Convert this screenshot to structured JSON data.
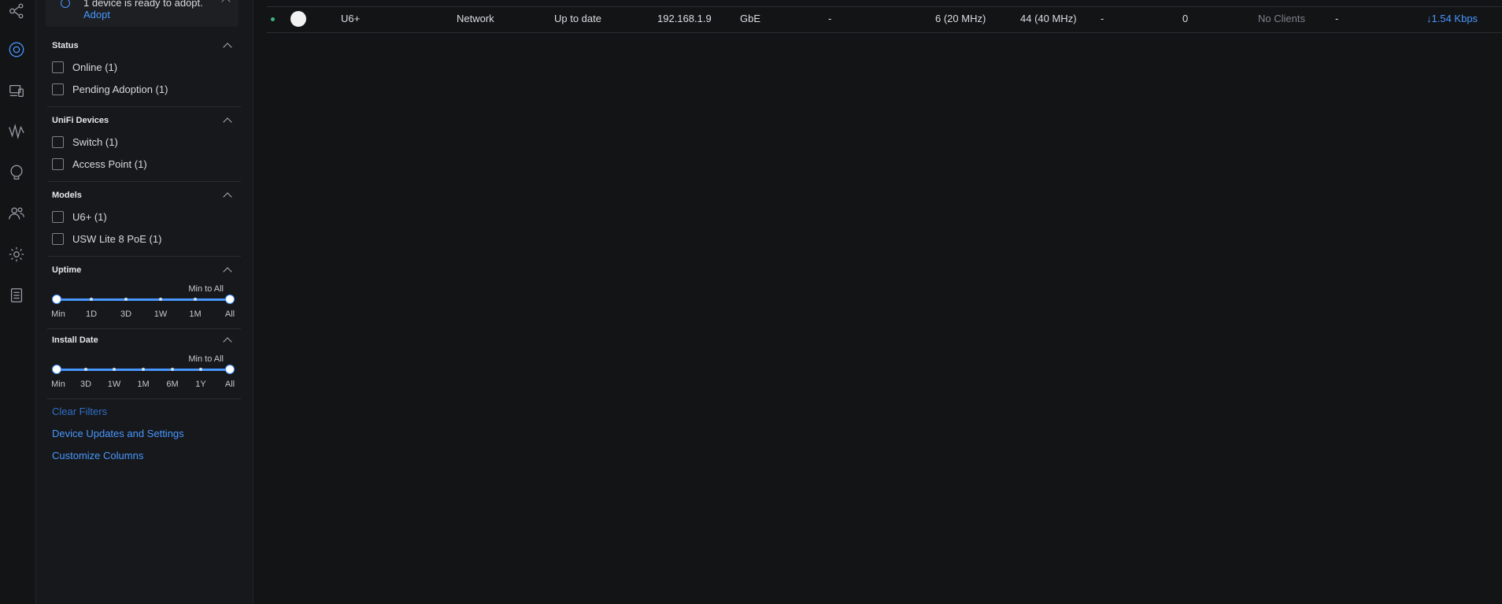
{
  "notice": {
    "text": "1 device is ready to adopt.",
    "link": "Adopt"
  },
  "nav_icons": [
    "topology-icon",
    "devices-icon",
    "client-devices-icon",
    "statistics-icon",
    "insights-icon",
    "clients-icon",
    "settings-icon",
    "logs-icon"
  ],
  "filters": {
    "status": {
      "title": "Status",
      "options": [
        "Online (1)",
        "Pending Adoption (1)"
      ]
    },
    "unifi_devices": {
      "title": "UniFi Devices",
      "options": [
        "Switch (1)",
        "Access Point (1)"
      ]
    },
    "models": {
      "title": "Models",
      "options": [
        "U6+ (1)",
        "USW Lite 8 PoE (1)"
      ]
    },
    "uptime": {
      "title": "Uptime",
      "range": "Min to All",
      "ticks": [
        "Min",
        "1D",
        "3D",
        "1W",
        "1M",
        "All"
      ]
    },
    "install_date": {
      "title": "Install Date",
      "range": "Min to All",
      "ticks": [
        "Min",
        "3D",
        "1W",
        "1M",
        "6M",
        "1Y",
        "All"
      ]
    }
  },
  "links": {
    "clear": "Clear Filters",
    "updates": "Device Updates and Settings",
    "columns": "Customize Columns"
  },
  "device_row": {
    "name": "U6+",
    "network": "Network",
    "firmware": "Up to date",
    "ip": "192.168.1.9",
    "uplink": "GbE",
    "col6": "-",
    "ch24": "6 (20 MHz)",
    "ch5": "44 (40 MHz)",
    "col9": "-",
    "col10": "0",
    "clients": "No Clients",
    "col12": "-",
    "rate": "↓1.54 Kbps"
  },
  "colors": {
    "accent": "#4797ff",
    "online": "#3fb37f",
    "bg": "#131416"
  }
}
